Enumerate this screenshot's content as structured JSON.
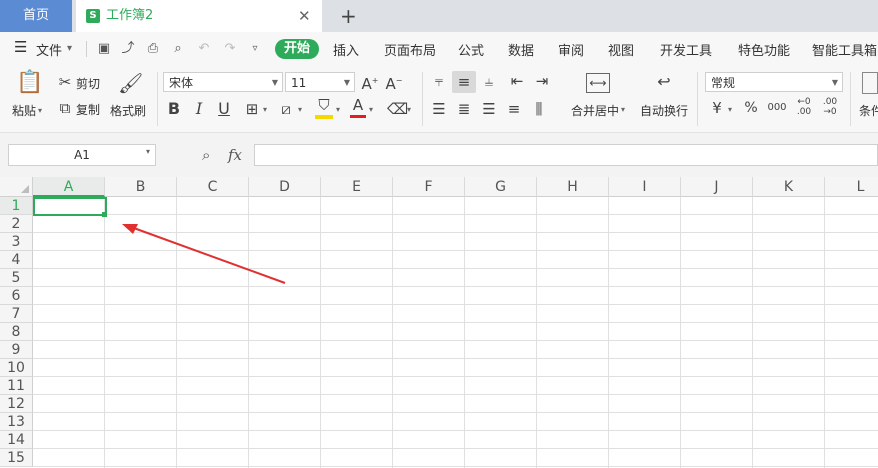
{
  "tabs": {
    "home": "首页",
    "doc_badge": "S",
    "doc_title": "工作簿2",
    "close": "✕",
    "new_tab": "+"
  },
  "menu": {
    "hamburger": "☰",
    "file": "文件",
    "items": [
      "开始",
      "插入",
      "页面布局",
      "公式",
      "数据",
      "审阅",
      "视图",
      "开发工具",
      "特色功能",
      "智能工具箱"
    ]
  },
  "ribbon": {
    "paste": "粘贴",
    "cut": "剪切",
    "copy": "复制",
    "format_painter": "格式刷",
    "font_name": "宋体",
    "font_size": "11",
    "bold": "B",
    "italic": "I",
    "underline": "U",
    "merge_center": "合并居中",
    "wrap_text": "自动换行",
    "number_format": "常规",
    "currency": "¥",
    "percent": "%",
    "thousands": "000",
    "cond": "条件",
    "font_color": "#e02020",
    "fill_color": "#f5d800"
  },
  "formula_bar": {
    "name_box": "A1",
    "fx": "fx",
    "formula": ""
  },
  "grid": {
    "columns": [
      "A",
      "B",
      "C",
      "D",
      "E",
      "F",
      "G",
      "H",
      "I",
      "J",
      "K",
      "L"
    ],
    "rows": [
      "1",
      "2",
      "3",
      "4",
      "5",
      "6",
      "7",
      "8",
      "9",
      "10",
      "11",
      "12",
      "13",
      "14",
      "15"
    ],
    "selected_cell": "A1",
    "accent": "#2eab5a",
    "arrow_color": "#e03030"
  }
}
